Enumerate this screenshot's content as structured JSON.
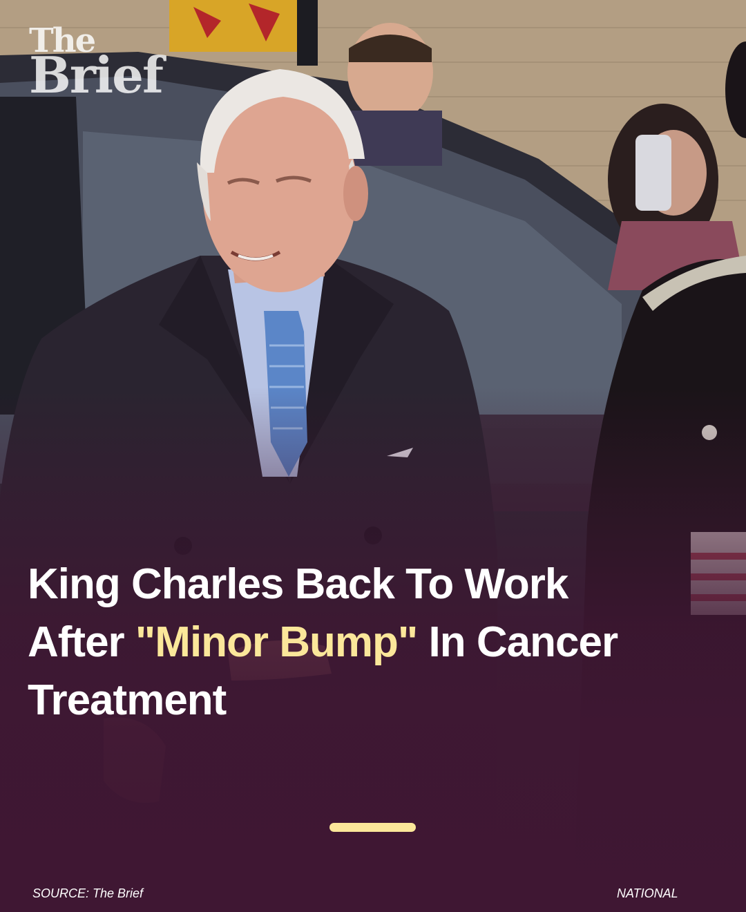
{
  "brand": {
    "logo_line1": "The",
    "logo_line2": "Brief"
  },
  "headline": {
    "part1": "King Charles Back To Work After ",
    "highlight": "\"Minor Bump\"",
    "part2": " In Cancer Treatment"
  },
  "photo": {
    "alt": "King Charles in a dark overcoat and blue tie beside a car, with onlookers and a uniformed officer"
  },
  "footer": {
    "source": "SOURCE: The Brief",
    "category": "NATIONAL"
  },
  "colors": {
    "background": "#3f1733",
    "highlight": "#fbe79a",
    "text": "#ffffff"
  }
}
